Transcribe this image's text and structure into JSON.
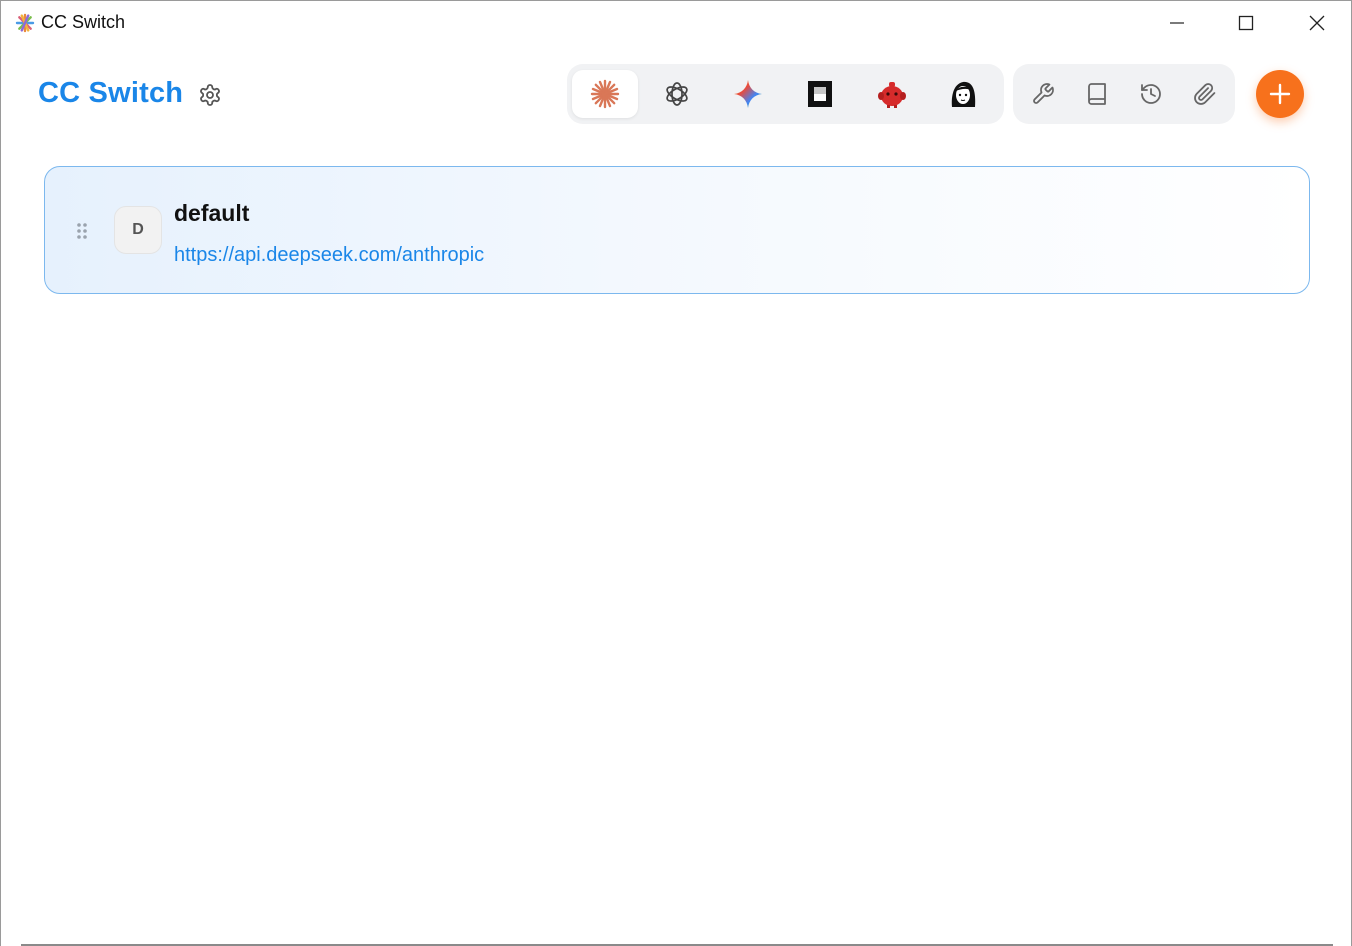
{
  "window": {
    "title": "CC Switch",
    "controls": [
      "minimize-icon",
      "maximize-icon",
      "close-icon"
    ]
  },
  "header": {
    "brand": "CC Switch",
    "settings_icon": "gear-icon"
  },
  "app_switcher": {
    "active_index": 0,
    "apps": [
      {
        "icon": "claude-icon",
        "color": "#d97757"
      },
      {
        "icon": "openai-icon",
        "color": "#444444"
      },
      {
        "icon": "gemini-icon",
        "color": "#4285f4"
      },
      {
        "icon": "opencode-icon",
        "color": "#111111"
      },
      {
        "icon": "red-robot-icon",
        "color": "#d62b2b"
      },
      {
        "icon": "avatar-face-icon",
        "color": "#111111"
      }
    ]
  },
  "tools": [
    {
      "icon": "wrench-icon"
    },
    {
      "icon": "book-icon"
    },
    {
      "icon": "history-icon"
    },
    {
      "icon": "paperclip-icon"
    }
  ],
  "add_button": {
    "icon": "plus-icon",
    "color": "#f7711c"
  },
  "providers": [
    {
      "initial": "D",
      "name": "default",
      "url": "https://api.deepseek.com/anthropic",
      "active": true
    }
  ],
  "colors": {
    "accent": "#1a86e8",
    "add": "#f7711c",
    "card_border": "#7cb8ee"
  }
}
